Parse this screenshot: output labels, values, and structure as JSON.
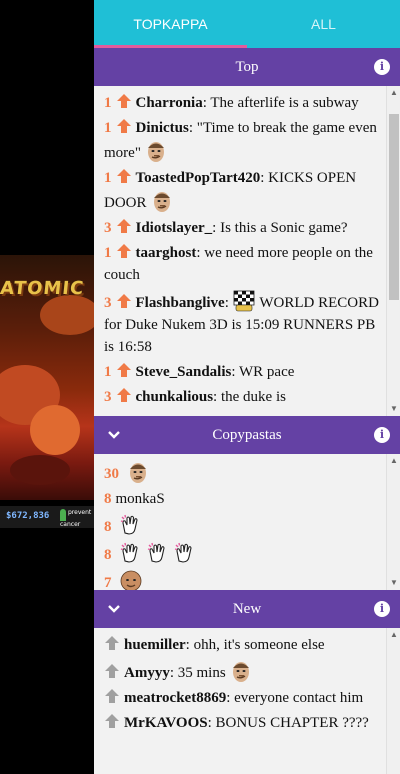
{
  "video": {
    "logo_text": "ATOMIC",
    "donation_amount": "$672,836",
    "sponsor_text": "prevent cancer"
  },
  "tabs": [
    {
      "label": "TOPKAPPA",
      "active": true
    },
    {
      "label": "ALL",
      "active": false
    }
  ],
  "colors": {
    "tab_bar": "#1fbfd6",
    "tab_indicator": "#e35b9c",
    "section_header": "#6441a4",
    "count_orange": "#f07a47",
    "upvote_gray": "#a0a0a0"
  },
  "sections": {
    "top": {
      "title": "Top",
      "messages": [
        {
          "count": "1",
          "user": "Charronia",
          "text": ": The afterlife is a subway"
        },
        {
          "count": "1",
          "user": "Dinictus",
          "text": ": \"Time to break the game even more\"",
          "emote": "kappa-face-emote"
        },
        {
          "count": "1",
          "user": "ToastedPopTart420",
          "text": ": KICKS OPEN DOOR",
          "emote": "kappa-face-emote"
        },
        {
          "count": "3",
          "user": "Idiotslayer_",
          "text": ": Is this a Sonic game?"
        },
        {
          "count": "1",
          "user": "taarghost",
          "text": ": we need more people on the couch"
        },
        {
          "count": "3",
          "user": "Flashbanglive",
          "text": ": WORLD RECORD for Duke Nukem 3D is 15:09 RUNNERS PB is 16:58",
          "emote": "checkered-flag-emote",
          "emote_after_colon": true
        },
        {
          "count": "1",
          "user": "Steve_Sandalis",
          "text": ": WR pace"
        },
        {
          "count": "3",
          "user": "chunkalious",
          "text": ": the duke is"
        }
      ]
    },
    "copypastas": {
      "title": "Copypastas",
      "messages": [
        {
          "count": "30",
          "emote": "kappa-face-emote"
        },
        {
          "count": "8",
          "text": "monkaS"
        },
        {
          "count": "8",
          "emote": "clap-hand-emote"
        },
        {
          "count": "8",
          "emote": "clap-hand-emote",
          "repeat": 3
        },
        {
          "count": "7",
          "emote": "bald-face-emote"
        }
      ]
    },
    "new": {
      "title": "New",
      "messages": [
        {
          "user": "huemiller",
          "text": ": ohh, it's someone else"
        },
        {
          "user": "Amyyy",
          "text": ": 35 mins",
          "emote": "kappa-face-emote"
        },
        {
          "user": "meatrocket8869",
          "text": ": everyone contact him"
        },
        {
          "user": "MrKAVOOS",
          "text": ": BONUS CHAPTER ????"
        }
      ]
    }
  }
}
